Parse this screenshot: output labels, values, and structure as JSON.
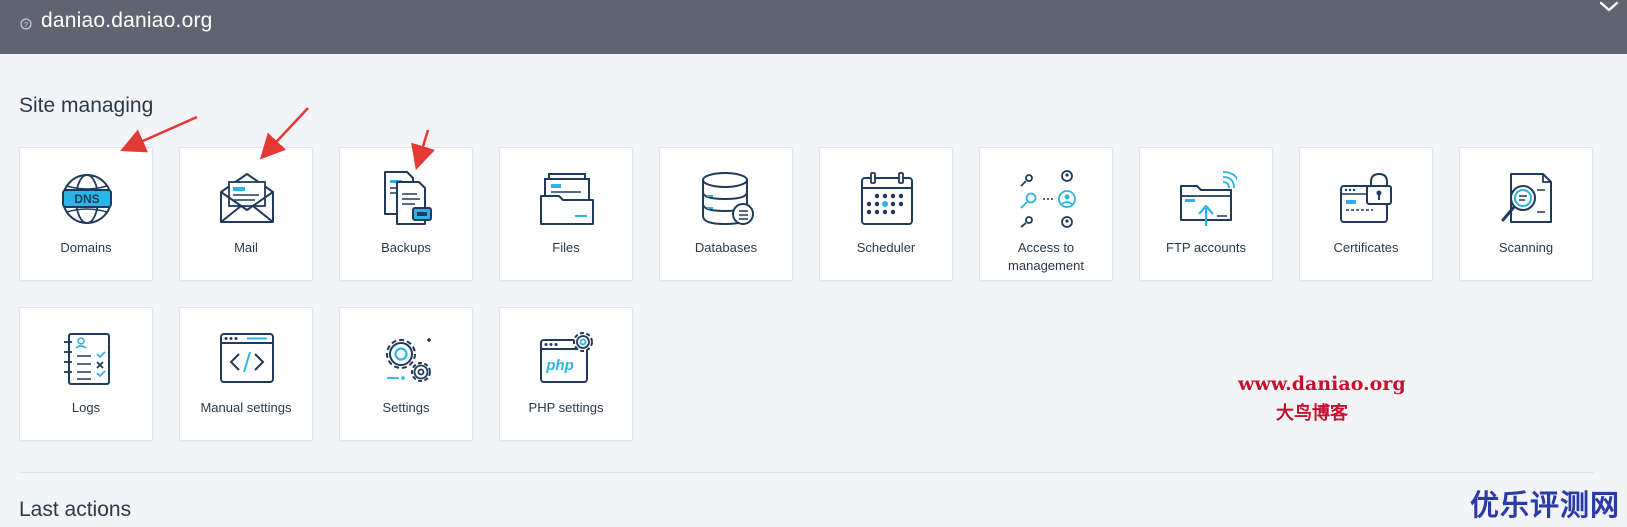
{
  "header": {
    "site_name": "daniao.daniao.org"
  },
  "sections": {
    "site_managing": "Site managing",
    "last_actions": "Last actions"
  },
  "tiles": [
    {
      "label": "Domains",
      "icon": "dns-globe-icon"
    },
    {
      "label": "Mail",
      "icon": "envelope-icon"
    },
    {
      "label": "Backups",
      "icon": "backup-documents-icon"
    },
    {
      "label": "Files",
      "icon": "file-folder-icon"
    },
    {
      "label": "Databases",
      "icon": "database-icon"
    },
    {
      "label": "Scheduler",
      "icon": "calendar-icon"
    },
    {
      "label": "Access to management",
      "icon": "keys-users-icon"
    },
    {
      "label": "FTP accounts",
      "icon": "ftp-folder-icon"
    },
    {
      "label": "Certificates",
      "icon": "certificate-lock-icon"
    },
    {
      "label": "Scanning",
      "icon": "magnifier-document-icon"
    },
    {
      "label": "Logs",
      "icon": "log-notebook-icon"
    },
    {
      "label": "Manual settings",
      "icon": "code-window-icon"
    },
    {
      "label": "Settings",
      "icon": "gears-icon"
    },
    {
      "label": "PHP settings",
      "icon": "php-window-icon"
    }
  ],
  "watermarks": {
    "url": "www.daniao.org",
    "blog": "大鸟博客",
    "corner": "优乐评测网"
  },
  "colors": {
    "header_bg": "#5f6570",
    "icon_dark": "#1f3a5a",
    "icon_accent": "#2bb5e6",
    "annotation_arrow": "#e53935",
    "watermark_red": "#c8102e",
    "watermark_blue": "#2a3aa8"
  }
}
